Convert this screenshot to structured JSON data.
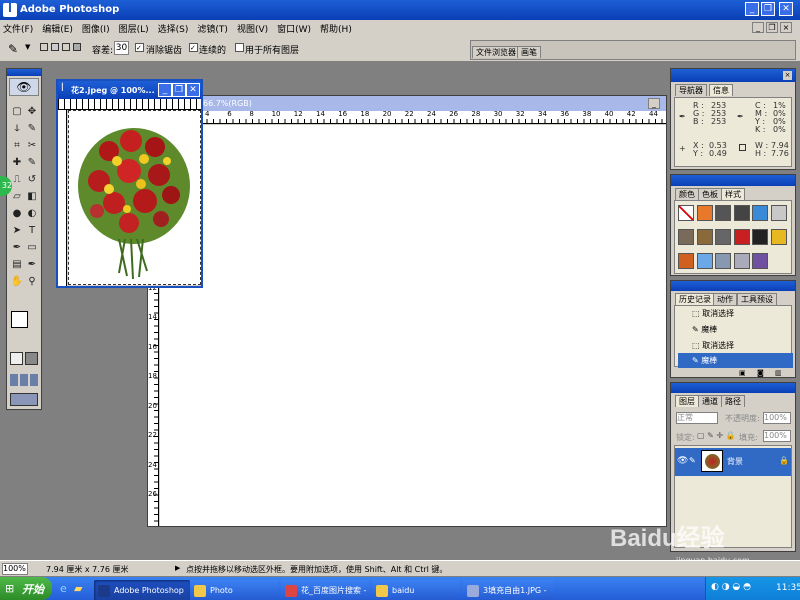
{
  "app": {
    "title": "Adobe Photoshop"
  },
  "menu": [
    "文件(F)",
    "编辑(E)",
    "图像(I)",
    "图层(L)",
    "选择(S)",
    "滤镜(T)",
    "视图(V)",
    "窗口(W)",
    "帮助(H)"
  ],
  "options": {
    "tolerance_label": "容差:",
    "tolerance_value": "30",
    "antialias": "消除锯齿",
    "contiguous": "连续的",
    "all_layers": "用于所有图层",
    "tab_browser": "文件浏览器",
    "tab_brush": "画笔"
  },
  "image_window": {
    "title": "花2.jpeg @ 100%..."
  },
  "canvas_window": {
    "title": "66.7%(RGB)"
  },
  "ruler_marks": [
    "4",
    "6",
    "8",
    "10",
    "12",
    "14",
    "16",
    "18",
    "20",
    "22",
    "24",
    "26",
    "28",
    "30",
    "32",
    "34",
    "36",
    "38",
    "40",
    "42",
    "44"
  ],
  "left_ruler_marks": [
    "2",
    "4",
    "6",
    "8",
    "10",
    "12",
    "14",
    "16",
    "18",
    "20",
    "22",
    "24",
    "26"
  ],
  "navigator": {
    "tabs": [
      "导航器",
      "信息"
    ],
    "r": "253",
    "g": "253",
    "b": "253",
    "c": "1%",
    "m": "0%",
    "y": "0%",
    "k": "0%",
    "x": "0.53",
    "y_coord": "0.49",
    "w": "7.94",
    "h": "7.76",
    "lbl_r": "R :",
    "lbl_g": "G :",
    "lbl_b": "B :",
    "lbl_c": "C :",
    "lbl_m": "M :",
    "lbl_y": "Y :",
    "lbl_k": "K :",
    "lbl_x": "X :",
    "lbl_yy": "Y :",
    "lbl_w": "W :",
    "lbl_h": "H :"
  },
  "colors_panel": {
    "tabs": [
      "颜色",
      "色板",
      "样式"
    ]
  },
  "history": {
    "tabs": [
      "历史记录",
      "动作",
      "工具预设"
    ],
    "items": [
      "取消选择",
      "魔棒",
      "取消选择",
      "魔棒"
    ]
  },
  "layers": {
    "tabs": [
      "图层",
      "通道",
      "路径"
    ],
    "mode": "正常",
    "opacity_label": "不透明度:",
    "opacity": "100%",
    "lock_label": "锁定:",
    "fill_label": "填充:",
    "fill": "100%",
    "layer_name": "背景"
  },
  "status": {
    "zoom": "100%",
    "doc": "7.94 厘米 x 7.76 厘米",
    "hint": "点按并拖移以移动选区外框。要用附加选项，使用 Shift、Alt 和 Ctrl 键。"
  },
  "taskbar": {
    "start": "开始",
    "tasks": [
      "Adobe Photoshop",
      "Photo",
      "花_百度图片搜索 - ...",
      "baidu",
      "3填充自由1.JPG - ..."
    ],
    "clock": "11:35"
  },
  "watermark": {
    "text": "Baidu经验",
    "sub": "jingyan.baidu.com"
  },
  "badge": "32"
}
